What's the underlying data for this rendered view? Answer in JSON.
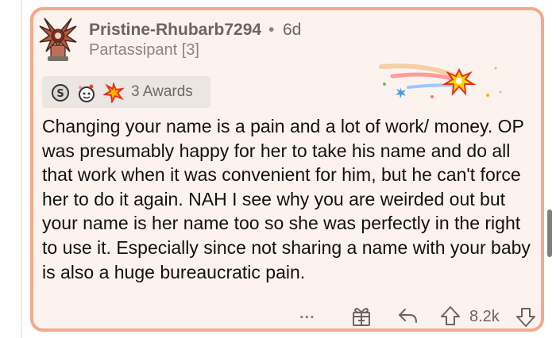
{
  "comment": {
    "username": "Pristine-Rhubarb7294",
    "separator": "•",
    "age": "6d",
    "flair": "Partassipant [3]",
    "awards": {
      "label": "3 Awards",
      "icons": [
        "silver-award-icon",
        "wholesome-award-icon",
        "starstruck-award-icon"
      ]
    },
    "body": "Changing your name is a pain and a lot of work/ money. OP was presumably happy for her to take his name and do all that work when it was convenient for him, but he can't force her to do it again. NAH I see why you are weirded out but your name is her name too so she was perfectly in the right to use it. Especially since not sharing a name with your baby is also a huge bureaucratic pain.",
    "actions": {
      "more": "...",
      "vote_count": "8.2k"
    }
  },
  "colors": {
    "card_border": "#f2a98d",
    "card_background": "#fdf3ee",
    "text": "#111111",
    "muted": "#6b6461"
  }
}
